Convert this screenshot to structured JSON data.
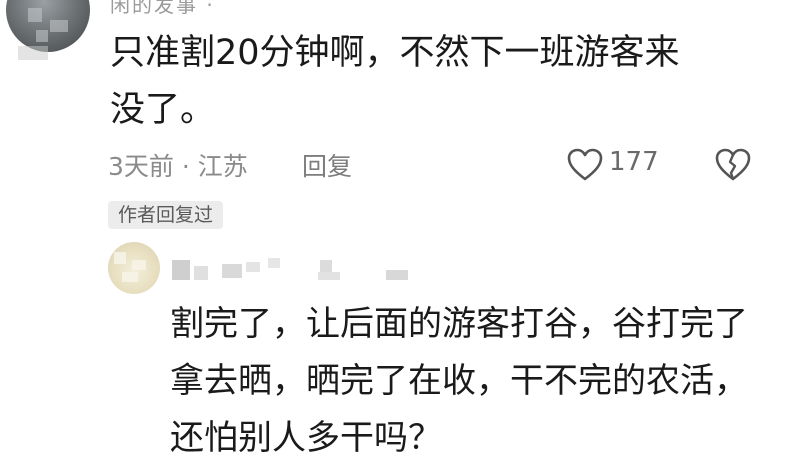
{
  "comment": {
    "username_partial": "闲的发事 ·",
    "text": "只准割20分钟啊，不然下一班游客来没了。",
    "time_location": "3天前 · 江苏",
    "reply_label": "回复",
    "like_count": "177"
  },
  "author_badge": "作者回复过",
  "reply": {
    "text": "割完了，让后面的游客打谷，谷打完了拿去晒，晒完了在收，干不完的农活，还怕别人多干吗？"
  },
  "colors": {
    "text": "#1a1a1a",
    "meta": "#8a8a8a",
    "badge_bg": "#ececec"
  },
  "icons": {
    "like": "heart-outline-icon",
    "dislike": "broken-heart-icon"
  }
}
